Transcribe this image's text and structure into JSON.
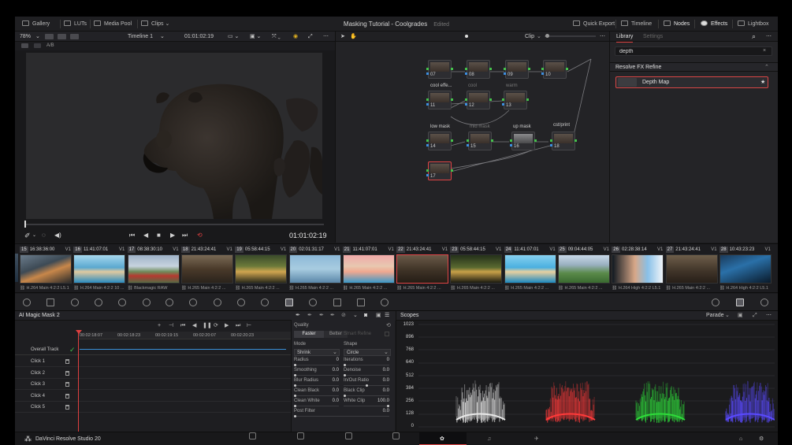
{
  "topbar": {
    "gallery": "Gallery",
    "luts": "LUTs",
    "media_pool": "Media Pool",
    "clips": "Clips",
    "title": "Masking Tutorial - Coolgrades",
    "edited": "Edited",
    "quick_export": "Quick Export",
    "timeline": "Timeline",
    "nodes": "Nodes",
    "effects": "Effects",
    "lightbox": "Lightbox"
  },
  "viewer": {
    "zoom": "78%",
    "timeline_name": "Timeline 1",
    "timecode_top": "01:01:02:19",
    "ab_label": "A/B",
    "timecode": "01:01:02:19",
    "clip_mode": "Clip"
  },
  "nodes": [
    {
      "num": "07",
      "label": ""
    },
    {
      "num": "08",
      "label": ""
    },
    {
      "num": "09",
      "label": ""
    },
    {
      "num": "10",
      "label": ""
    },
    {
      "num": "11",
      "label": "cool effe..."
    },
    {
      "num": "12",
      "label": "cool"
    },
    {
      "num": "13",
      "label": "warm"
    },
    {
      "num": "14",
      "label": "low mask"
    },
    {
      "num": "15",
      "label": "mid mask"
    },
    {
      "num": "16",
      "label": "up mask"
    },
    {
      "num": "18",
      "label": "cst/print"
    },
    {
      "num": "17",
      "label": ""
    }
  ],
  "effects_panel": {
    "tab_library": "Library",
    "tab_settings": "Settings",
    "search_value": "depth",
    "category": "Resolve FX Refine",
    "item": "Depth Map"
  },
  "clips": [
    {
      "num": "15",
      "tc": "16:38:36:00",
      "track": "V1",
      "codec": "H.264 Main 4:2:2 L5.1",
      "grad": "linear-gradient(160deg,#6b7c8c 0%,#3d4a55 40%,#c8874a 60%,#2a2a2a 100%)"
    },
    {
      "num": "16",
      "tc": "11:41:07:01",
      "track": "V1",
      "codec": "H.264 Main 4:2:2 10 ...",
      "grad": "linear-gradient(180deg,#a7d8ee 0%,#5aa8d0 45%,#e0c9a0 60%,#2a8bbf 100%)"
    },
    {
      "num": "17",
      "tc": "08:38:30:10",
      "track": "V1",
      "codec": "Blackmagic RAW",
      "grad": "linear-gradient(180deg,#9fb3c9 0%,#c7d3de 40%,#6e8b5a 60%,#b53a30 75%,#556b45 100%)"
    },
    {
      "num": "18",
      "tc": "21:43:24:41",
      "track": "V1",
      "codec": "H.265 Main 4:2:2 ...",
      "grad": "linear-gradient(180deg,#7a6a55 0%,#4a3a2a 50%,#2a231c 100%)"
    },
    {
      "num": "19",
      "tc": "05:58:44:15",
      "track": "V1",
      "codec": "H.265 Main 4:2:2 ...",
      "grad": "linear-gradient(180deg,#3a4a2a 0%,#6c7a3a 40%,#d0a550 60%,#2a2a1a 100%)"
    },
    {
      "num": "20",
      "tc": "02:01:31:17",
      "track": "V1",
      "codec": "H.265 Main 4:2:2 ...",
      "grad": "linear-gradient(180deg,#8cb8d8 0%,#a8cce0 50%,#5a86a8 100%)"
    },
    {
      "num": "21",
      "tc": "11:41:07:01",
      "track": "V1",
      "codec": "H.265 Main 4:2:2 ...",
      "grad": "linear-gradient(180deg,#f0a8a8 0%,#e8c8b0 40%,#f0a890 60%,#3a98c8 100%)"
    },
    {
      "num": "22",
      "tc": "21:43:24:41",
      "track": "V1",
      "codec": "H.265 Main 4:2:2 ...",
      "grad": "linear-gradient(180deg,#6a5a48 0%,#3e3226 55%,#251d16 100%)"
    },
    {
      "num": "23",
      "tc": "05:58:44:15",
      "track": "V1",
      "codec": "H.265 Main 4:2:2 ...",
      "grad": "linear-gradient(180deg,#24301a 0%,#5a6a30 45%,#c8a048 60%,#1a1a10 100%)"
    },
    {
      "num": "24",
      "tc": "11:41:07:01",
      "track": "V1",
      "codec": "H.265 Main 4:2:2 ...",
      "grad": "linear-gradient(180deg,#88d0f0 0%,#4ab0e0 45%,#e8d0a0 60%,#1a88c0 100%)"
    },
    {
      "num": "25",
      "tc": "09:04:44:05",
      "track": "V1",
      "codec": "H.265 Main 4:2:2 ...",
      "grad": "linear-gradient(180deg,#c8d8e8 0%,#9ab0c0 35%,#5a8a4a 65%,#3a6a30 100%)"
    },
    {
      "num": "26",
      "tc": "02:28:38:14",
      "track": "V1",
      "codec": "H.264 High 4:2:2 L5.1",
      "grad": "linear-gradient(90deg,#101820 0%,#d8a888 45%,#88c0e8 70%,#f0f4f8 100%)"
    },
    {
      "num": "27",
      "tc": "21:43:24:41",
      "track": "V1",
      "codec": "H.265 Main 4:2:2 ...",
      "grad": "linear-gradient(180deg,#6e5e4a 0%,#42362a 55%,#271f18 100%)"
    },
    {
      "num": "28",
      "tc": "10:43:23:23",
      "track": "V1",
      "codec": "H.264 High 4:2:2 L5.1",
      "grad": "linear-gradient(160deg,#1a3a5a 0%,#2a70a8 40%,#0a1a2a 100%)"
    }
  ],
  "mask_panel": {
    "title": "AI Magic Mask 2",
    "ruler": [
      "00:02:18:07",
      "00:02:18:23",
      "00:02:19:15",
      "00:02:20:07",
      "00:02:20:23"
    ],
    "tracks": [
      "Overall Track",
      "Click 1",
      "Click 2",
      "Click 3",
      "Click 4",
      "Click 5"
    ]
  },
  "quality": {
    "label": "Quality",
    "faster": "Faster",
    "better": "Better",
    "smart_refine": "Smart Refine",
    "mode_label": "Mode",
    "mode_value": "Shrink",
    "shape_label": "Shape",
    "shape_value": "Circle",
    "radius": "Radius",
    "radius_val": "0",
    "iterations": "Iterations",
    "iterations_val": "0",
    "smoothing": "Smoothing",
    "smoothing_val": "0.0",
    "denoise": "Denoise",
    "denoise_val": "0.0",
    "blur_radius": "Blur Radius",
    "blur_radius_val": "0.0",
    "inout_ratio": "In/Out Ratio",
    "inout_ratio_val": "0.0",
    "clean_black": "Clean Black",
    "clean_black_val": "0.0",
    "black_clip": "Black Clip",
    "black_clip_val": "0.0",
    "clean_white": "Clean White",
    "clean_white_val": "0.0",
    "white_clip": "White Clip",
    "white_clip_val": "100.0",
    "post_filter": "Post Filter",
    "post_filter_val": "0.0"
  },
  "scopes": {
    "title": "Scopes",
    "mode": "Parade",
    "y_labels": [
      "1023",
      "896",
      "768",
      "640",
      "512",
      "384",
      "256",
      "128",
      "0"
    ],
    "colors": {
      "red": "#ff3a3a",
      "green": "#2edc3a",
      "blue": "#5a4aff",
      "white": "#e8e8e8"
    }
  },
  "status": {
    "app": "DaVinci Resolve Studio 20",
    "accent": "#e04444"
  }
}
